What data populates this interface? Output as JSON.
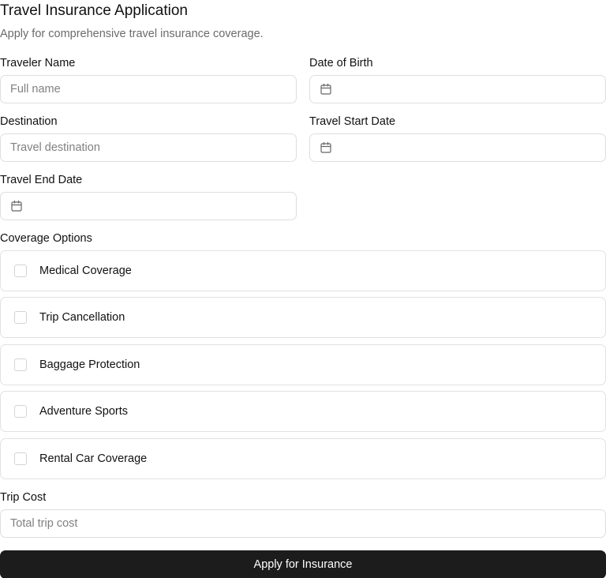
{
  "header": {
    "title": "Travel Insurance Application",
    "subtitle": "Apply for comprehensive travel insurance coverage."
  },
  "fields": {
    "traveler_name": {
      "label": "Traveler Name",
      "placeholder": "Full name",
      "value": ""
    },
    "date_of_birth": {
      "label": "Date of Birth",
      "value": "",
      "icon": "calendar-icon"
    },
    "destination": {
      "label": "Destination",
      "placeholder": "Travel destination",
      "value": ""
    },
    "travel_start_date": {
      "label": "Travel Start Date",
      "value": "",
      "icon": "calendar-icon"
    },
    "travel_end_date": {
      "label": "Travel End Date",
      "value": "",
      "icon": "calendar-icon"
    },
    "trip_cost": {
      "label": "Trip Cost",
      "placeholder": "Total trip cost",
      "value": ""
    }
  },
  "coverage": {
    "label": "Coverage Options",
    "options": [
      {
        "label": "Medical Coverage",
        "checked": false
      },
      {
        "label": "Trip Cancellation",
        "checked": false
      },
      {
        "label": "Baggage Protection",
        "checked": false
      },
      {
        "label": "Adventure Sports",
        "checked": false
      },
      {
        "label": "Rental Car Coverage",
        "checked": false
      }
    ]
  },
  "submit": {
    "label": "Apply for Insurance"
  },
  "colors": {
    "button_bg": "#1c1c1c",
    "border": "#dedede",
    "muted_text": "#6b6b6b"
  }
}
